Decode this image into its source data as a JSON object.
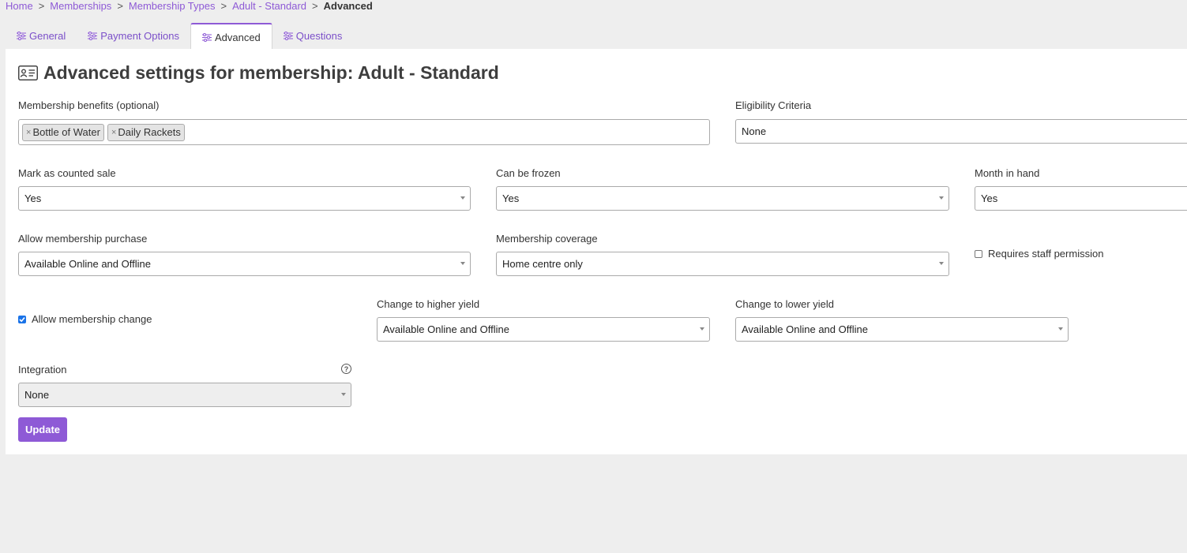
{
  "breadcrumb": {
    "items": [
      "Home",
      "Memberships",
      "Membership Types",
      "Adult - Standard"
    ],
    "current": "Advanced",
    "separator": ">"
  },
  "tabs": [
    {
      "label": "General",
      "active": false
    },
    {
      "label": "Payment Options",
      "active": false
    },
    {
      "label": "Advanced",
      "active": true
    },
    {
      "label": "Questions",
      "active": false
    }
  ],
  "page": {
    "title": "Advanced settings for membership: Adult - Standard"
  },
  "form": {
    "benefits": {
      "label": "Membership benefits (optional)",
      "tags": [
        "Bottle of Water",
        "Daily Rackets"
      ]
    },
    "eligibility": {
      "label": "Eligibility Criteria",
      "value": "None"
    },
    "counted_sale": {
      "label": "Mark as counted sale",
      "value": "Yes"
    },
    "can_be_frozen": {
      "label": "Can be frozen",
      "value": "Yes"
    },
    "month_in_hand": {
      "label": "Month in hand",
      "value": "Yes"
    },
    "allow_purchase": {
      "label": "Allow membership purchase",
      "value": "Available Online and Offline"
    },
    "coverage": {
      "label": "Membership coverage",
      "value": "Home centre only"
    },
    "staff_permission": {
      "label": "Requires staff permission",
      "checked": false
    },
    "allow_change": {
      "label": "Allow membership change",
      "checked": true
    },
    "higher_yield": {
      "label": "Change to higher yield",
      "value": "Available Online and Offline"
    },
    "lower_yield": {
      "label": "Change to lower yield",
      "value": "Available Online and Offline"
    },
    "integration": {
      "label": "Integration",
      "value": "None"
    },
    "help_glyph": "?",
    "update_label": "Update"
  },
  "colors": {
    "accent": "#8e5ad6",
    "checkbox": "#1a73e8",
    "background": "#eeeeee"
  }
}
